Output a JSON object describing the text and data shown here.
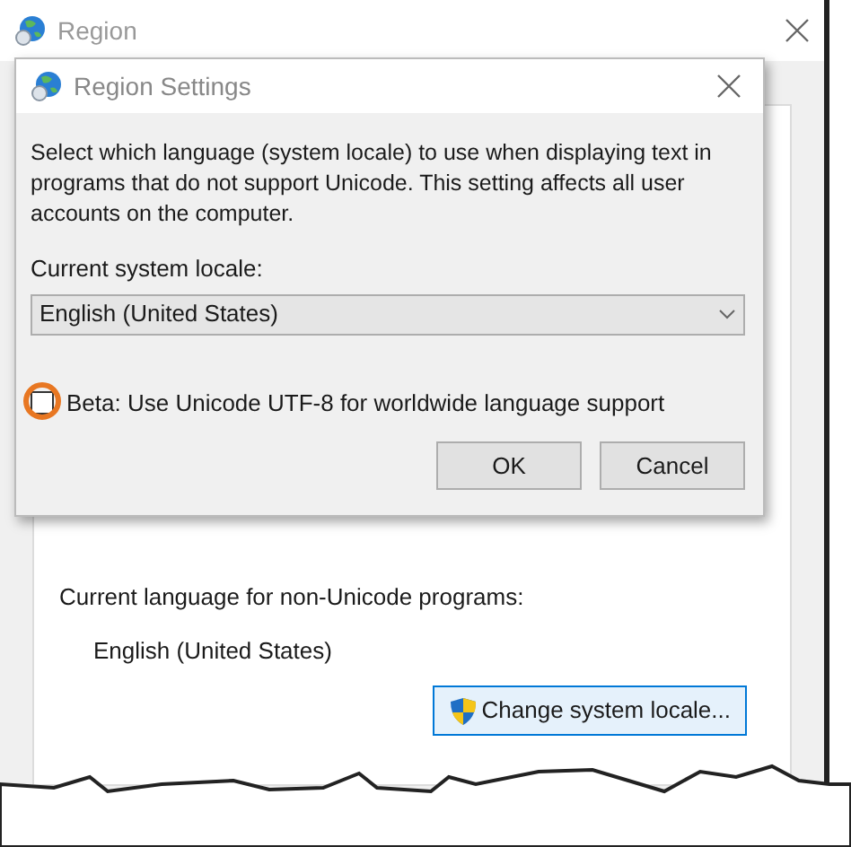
{
  "window": {
    "title": "Region"
  },
  "dialog": {
    "title": "Region Settings",
    "description": "Select which language (system locale) to use when displaying text in programs that do not support Unicode. This setting affects all user accounts on the computer.",
    "locale_label": "Current system locale:",
    "locale_select": {
      "value": "English (United States)"
    },
    "beta_option": {
      "label": "Beta: Use Unicode UTF-8 for worldwide language support",
      "checked": false,
      "highlighted": true
    },
    "buttons": [
      "OK",
      "Cancel"
    ]
  },
  "panel": {
    "label": "Current language for non-Unicode programs:",
    "value": "English (United States)",
    "button": "Change system locale..."
  }
}
